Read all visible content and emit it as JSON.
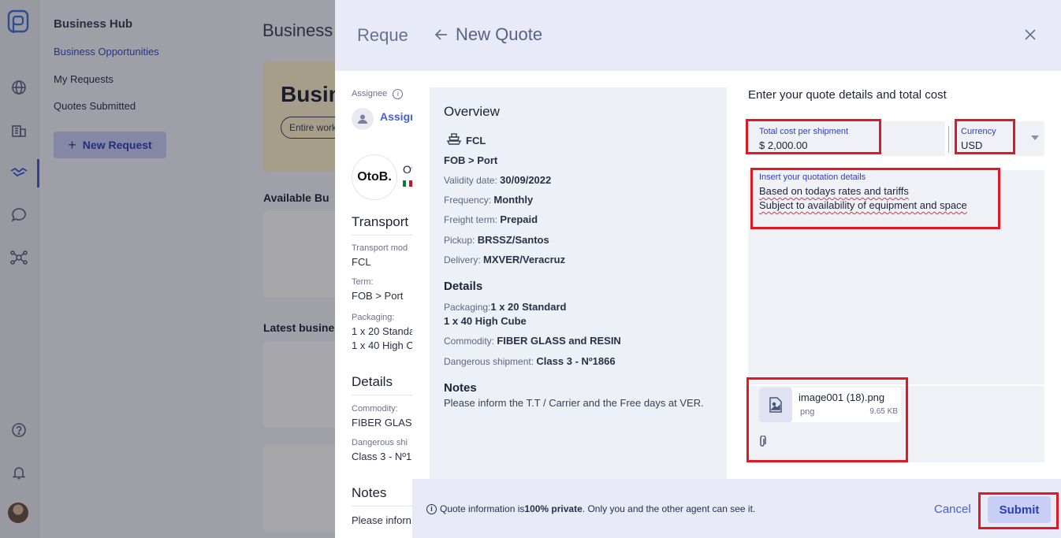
{
  "nav": {
    "title": "Business Hub",
    "items": [
      {
        "label": "Business Opportunities"
      },
      {
        "label": "My Requests"
      },
      {
        "label": "Quotes Submitted"
      }
    ],
    "new_request_label": "New Request"
  },
  "main": {
    "heading": "Business",
    "banner_title": "Busin",
    "banner_button": "Entire work",
    "available_label": "Available Bu",
    "latest_label": "Latest busine"
  },
  "request": {
    "title": "Reque",
    "assignee_label": "Assignee",
    "assign_link": "Assign",
    "company_short": "Ot",
    "logo_text": "OtoB.",
    "transport_heading": "Transport",
    "transport_mode_label": "Transport mod",
    "transport_mode_value": "FCL",
    "term_label": "Term:",
    "term_value": "FOB > Port",
    "packaging_label": "Packaging:",
    "packaging_value_1": "1 x 20 Standa",
    "packaging_value_2": "1 x 40 High C",
    "details_heading": "Details",
    "commodity_label": "Commodity:",
    "commodity_value": "FIBER GLASS",
    "dangerous_label": "Dangerous shi",
    "dangerous_value": "Class 3 - Nº1",
    "notes_heading": "Notes",
    "notes_value": "Please inforn"
  },
  "modal": {
    "title": "New Quote",
    "overview": {
      "heading": "Overview",
      "mode": "FCL",
      "term": "FOB > Port",
      "validity_label": "Validity date:",
      "validity_value": "30/09/2022",
      "frequency_label": "Frequency:",
      "frequency_value": "Monthly",
      "freight_label": "Freight term:",
      "freight_value": "Prepaid",
      "pickup_label": "Pickup:",
      "pickup_value": "BRSSZ/Santos",
      "delivery_label": "Delivery:",
      "delivery_value": "MXVER/Veracruz",
      "details_heading": "Details",
      "packaging_label": "Packaging:",
      "packaging_value_1": "1 x 20 Standard",
      "packaging_value_2": "1 x 40 High Cube",
      "commodity_label": "Commodity:",
      "commodity_value": "FIBER GLASS and RESIN",
      "dangerous_label": "Dangerous shipment:",
      "dangerous_value": "Class 3 - Nº1866",
      "notes_heading": "Notes",
      "notes_value": "Please inform the T.T / Carrier and the Free days at VER."
    },
    "form": {
      "title": "Enter your quote details and total cost",
      "total_label": "Total cost per shipment",
      "total_value": "$ 2,000.00",
      "currency_label": "Currency",
      "currency_value": "USD",
      "details_label": "Insert your quotation details",
      "details_value": "Based on todays rates and tariffs\nSubject to availability of equipment and space",
      "attachment": {
        "name": "image001 (18).png",
        "type": "png",
        "size": "9.65 KB"
      }
    },
    "footer": {
      "info_pre": "Quote information is ",
      "info_bold": "100% private",
      "info_post": ". Only you and the other agent can see it.",
      "cancel": "Cancel",
      "submit": "Submit"
    }
  },
  "colors": {
    "accent": "#2d4ad0",
    "highlight": "#e01a22",
    "button_bg": "#c8cff6"
  },
  "icons": [
    "app-logo-icon",
    "globe-icon",
    "building-icon",
    "handshake-icon",
    "chat-icon",
    "network-icon",
    "help-icon",
    "bell-icon",
    "info-icon",
    "ship-icon",
    "image-file-icon",
    "paperclip-icon",
    "arrow-left-icon",
    "close-icon",
    "plus-icon",
    "user-icon"
  ]
}
